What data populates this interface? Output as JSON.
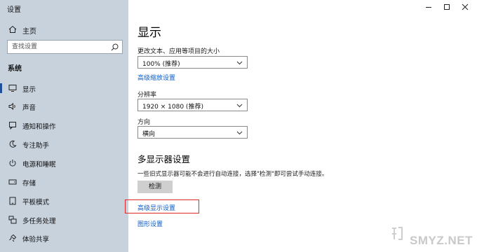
{
  "app_title": "设置",
  "sidebar": {
    "home_label": "主页",
    "search_placeholder": "查找设置",
    "section_title": "系统",
    "items": [
      {
        "label": "显示",
        "icon": "monitor-icon",
        "active": true
      },
      {
        "label": "声音",
        "icon": "speaker-icon",
        "active": false
      },
      {
        "label": "通知和操作",
        "icon": "notification-icon",
        "active": false
      },
      {
        "label": "专注助手",
        "icon": "moon-icon",
        "active": false
      },
      {
        "label": "电源和睡眠",
        "icon": "power-icon",
        "active": false
      },
      {
        "label": "存储",
        "icon": "storage-icon",
        "active": false
      },
      {
        "label": "平板模式",
        "icon": "tablet-icon",
        "active": false
      },
      {
        "label": "多任务处理",
        "icon": "multitask-icon",
        "active": false
      },
      {
        "label": "体验共享",
        "icon": "share-icon",
        "active": false
      }
    ]
  },
  "main": {
    "title": "显示",
    "scale": {
      "label": "更改文本、应用等项目的大小",
      "value": "100% (推荐)"
    },
    "advanced_scaling_link": "高级缩放设置",
    "resolution": {
      "label": "分辨率",
      "value": "1920 × 1080 (推荐)"
    },
    "orientation": {
      "label": "方向",
      "value": "横向"
    },
    "multi_display": {
      "title": "多显示器设置",
      "description": "一些旧式显示器可能不会进行自动连接，选择\"检测\"即可尝试手动连接。",
      "detect_button": "检测"
    },
    "advanced_display_link": "高级显示设置",
    "graphics_link": "图形设置"
  },
  "watermark": {
    "text": "SMYZ.NET"
  },
  "colors": {
    "sidebar_bg": "#c8d2dd",
    "link": "#0b5cc8",
    "accent": "#1f4e9a",
    "highlight": "#e02a2a"
  }
}
